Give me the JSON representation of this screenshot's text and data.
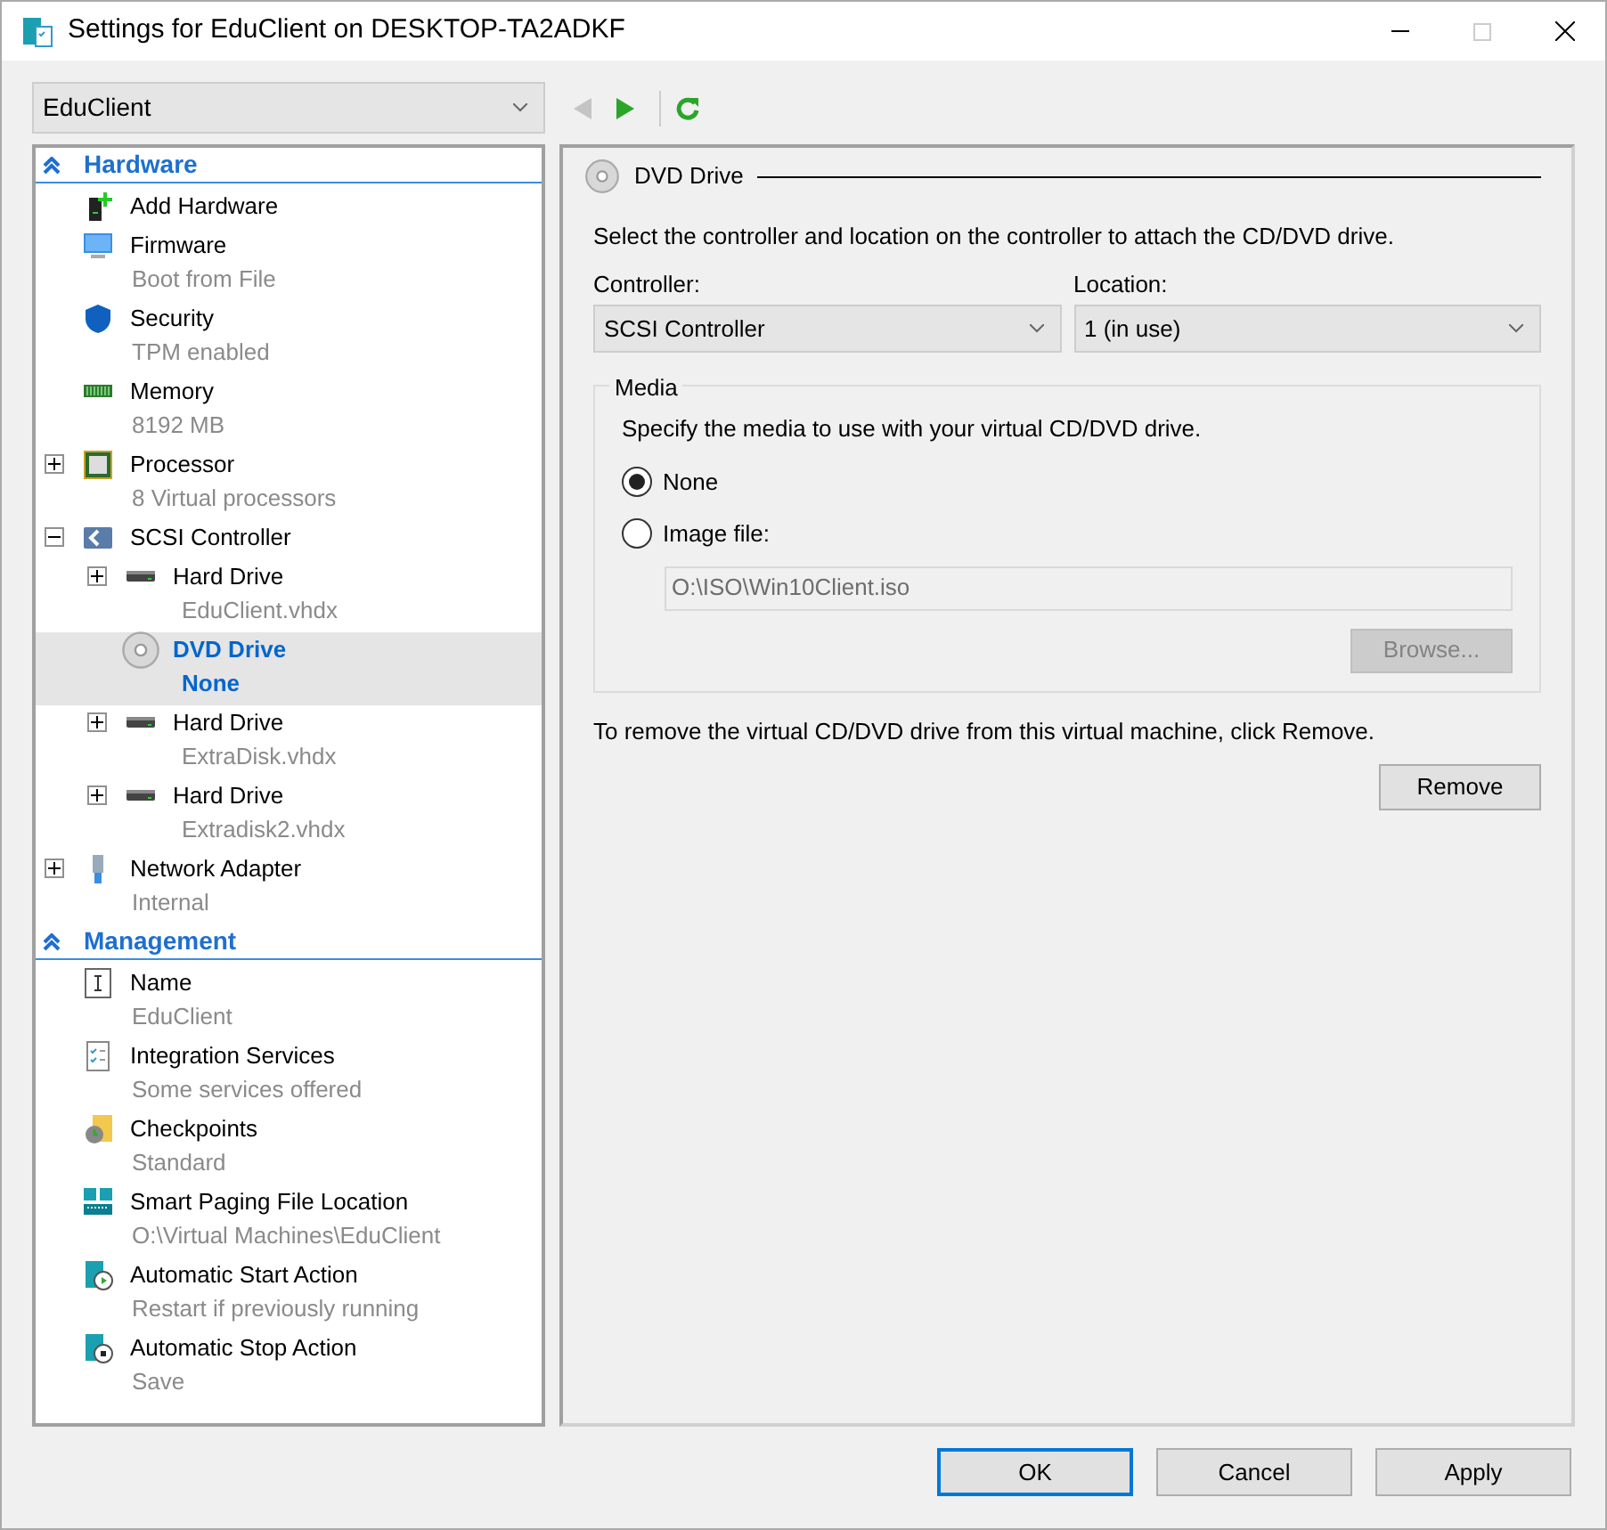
{
  "window": {
    "title": "Settings for EduClient on DESKTOP-TA2ADKF"
  },
  "vm_selector": {
    "value": "EduClient"
  },
  "navigation": {
    "back_enabled": false,
    "forward_enabled": true
  },
  "sections": [
    {
      "title": "Hardware",
      "expanded": true,
      "items": [
        {
          "label": "Add Hardware",
          "selected": false
        },
        {
          "label": "Firmware",
          "detail": "Boot from File",
          "selected": false
        },
        {
          "label": "Security",
          "detail": "TPM enabled",
          "selected": false
        },
        {
          "label": "Memory",
          "detail": "8192 MB",
          "selected": false
        },
        {
          "label": "Processor",
          "detail": "8 Virtual processors",
          "selected": false,
          "expanded": false
        },
        {
          "label": "SCSI Controller",
          "selected": false,
          "expanded": true,
          "children": [
            {
              "label": "Hard Drive",
              "detail": "EduClient.vhdx",
              "selected": false,
              "expanded": false
            },
            {
              "label": "DVD Drive",
              "detail": "None",
              "selected": true
            },
            {
              "label": "Hard Drive",
              "detail": "ExtraDisk.vhdx",
              "selected": false,
              "expanded": false
            },
            {
              "label": "Hard Drive",
              "detail": "Extradisk2.vhdx",
              "selected": false,
              "expanded": false
            }
          ]
        },
        {
          "label": "Network Adapter",
          "detail": "Internal",
          "selected": false,
          "expanded": false
        }
      ]
    },
    {
      "title": "Management",
      "expanded": true,
      "items": [
        {
          "label": "Name",
          "detail": "EduClient",
          "selected": false
        },
        {
          "label": "Integration Services",
          "detail": "Some services offered",
          "selected": false
        },
        {
          "label": "Checkpoints",
          "detail": "Standard",
          "selected": false
        },
        {
          "label": "Smart Paging File Location",
          "detail": "O:\\Virtual Machines\\EduClient",
          "selected": false
        },
        {
          "label": "Automatic Start Action",
          "detail": "Restart if previously running",
          "selected": false
        },
        {
          "label": "Automatic Stop Action",
          "detail": "Save",
          "selected": false
        }
      ]
    }
  ],
  "panel": {
    "title": "DVD Drive",
    "instruction": "Select the controller and location on the controller to attach the CD/DVD drive.",
    "controller": {
      "label": "Controller:",
      "value": "SCSI Controller"
    },
    "location": {
      "label": "Location:",
      "value": "1 (in use)"
    },
    "media": {
      "title": "Media",
      "instruction": "Specify the media to use with your virtual CD/DVD drive.",
      "options": [
        {
          "label": "None",
          "selected": true
        },
        {
          "label": "Image file:",
          "selected": false
        }
      ],
      "image_path": {
        "value": "O:\\ISO\\Win10Client.iso",
        "disabled": true
      },
      "browse": {
        "label": "Browse...",
        "disabled": true
      }
    },
    "remove_note": "To remove the virtual CD/DVD drive from this virtual machine, click Remove.",
    "remove_button": "Remove"
  },
  "buttons": [
    {
      "label": "OK",
      "default": true
    },
    {
      "label": "Cancel",
      "default": false
    },
    {
      "label": "Apply",
      "default": false
    }
  ]
}
